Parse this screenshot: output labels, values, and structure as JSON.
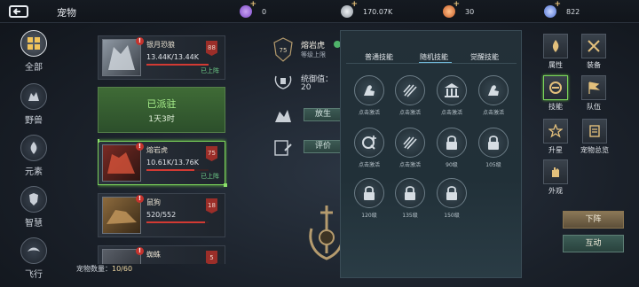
{
  "header": {
    "title": "宠物",
    "resources": [
      {
        "icon": "purple-gem-icon",
        "value": "0",
        "color": "#9b6ad8"
      },
      {
        "icon": "silver-coin-icon",
        "value": "170.07K",
        "color": "#b9c0c8"
      },
      {
        "icon": "orange-orb-icon",
        "value": "30",
        "color": "#e07a3a"
      },
      {
        "icon": "blue-crystal-icon",
        "value": "822",
        "color": "#6f8fe0"
      }
    ]
  },
  "categories": [
    {
      "label": "全部",
      "icon": "grid-icon",
      "active": true
    },
    {
      "label": "野兽",
      "icon": "beast-icon"
    },
    {
      "label": "元素",
      "icon": "element-icon"
    },
    {
      "label": "智慧",
      "icon": "wisdom-icon"
    },
    {
      "label": "飞行",
      "icon": "flying-icon"
    }
  ],
  "pets": [
    {
      "name": "银月恐狼",
      "hp": "13.44K/13.44K",
      "hp_fraction": 1.0,
      "level": "88",
      "status": "已上阵"
    },
    {
      "stationed_title": "已派驻",
      "stationed_time": "1天3时"
    },
    {
      "name": "熔岩虎",
      "hp": "10.61K/13.76K",
      "hp_fraction": 0.77,
      "level": "75",
      "status": "已上阵",
      "selected": true
    },
    {
      "name": "鼠狗",
      "hp": "520/552",
      "hp_fraction": 0.94,
      "level": "18"
    },
    {
      "name": "蜘蛛",
      "level": "5"
    }
  ],
  "pet_count": {
    "label": "宠物数量：",
    "value": "10/60"
  },
  "detail": {
    "name": "熔岩虎",
    "level_label": "等级上限",
    "badge_level": "75",
    "command_label": "统御值：",
    "command_value": "20",
    "release_button": "放生",
    "evaluate_button": "评价"
  },
  "skill_tabs": [
    "普通技能",
    "随机技能",
    "觉醒技能"
  ],
  "active_skill_tab": 1,
  "skills": [
    {
      "label": "点击激活",
      "icon": "arm-icon"
    },
    {
      "label": "点击激活",
      "icon": "claw-slash-icon"
    },
    {
      "label": "点击激活",
      "icon": "temple-icon"
    },
    {
      "label": "点击激活",
      "icon": "arm-icon"
    },
    {
      "label": "点击激活",
      "icon": "plus-q-icon"
    },
    {
      "label": "点击激活",
      "icon": "claw-slash-icon"
    },
    {
      "label": "90级",
      "icon": "lock-icon"
    },
    {
      "label": "105级",
      "icon": "lock-icon"
    },
    {
      "label": "120级",
      "icon": "lock-icon"
    },
    {
      "label": "135级",
      "icon": "lock-icon"
    },
    {
      "label": "150级",
      "icon": "lock-icon"
    }
  ],
  "actions": [
    {
      "label": "属性",
      "icon": "flame-icon"
    },
    {
      "label": "装备",
      "icon": "swords-icon"
    },
    {
      "label": "技能",
      "icon": "skill-icon",
      "active": true
    },
    {
      "label": "队伍",
      "icon": "flag-icon"
    },
    {
      "label": "升星",
      "icon": "star-icon"
    },
    {
      "label": "宠物总览",
      "icon": "book-icon"
    },
    {
      "label": "外观",
      "icon": "hand-icon"
    }
  ],
  "buttons": {
    "withdraw": "下阵",
    "interact": "互动"
  }
}
